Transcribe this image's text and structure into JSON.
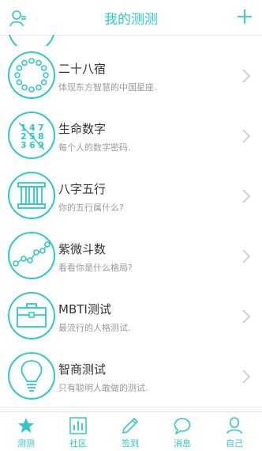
{
  "colors": {
    "accent": "#2ec9c7",
    "text": "#333333",
    "subtext": "#9a9a9a"
  },
  "header": {
    "title": "我的测测",
    "left_icon": "user-icon",
    "right_icon": "plus-icon"
  },
  "list": {
    "items": [
      {
        "name": "二十八宿",
        "desc": "体现东方智慧的中国星座.",
        "icon": "constellation-ring-icon"
      },
      {
        "name": "生命数字",
        "desc": "每个人的数字密码.",
        "icon": "number-grid-icon",
        "icon_digits": [
          "1",
          "4",
          "7",
          "2",
          "5",
          "8",
          "3",
          "6",
          "9"
        ]
      },
      {
        "name": "八字五行",
        "desc": "你的五行属什么?",
        "icon": "pillars-icon"
      },
      {
        "name": "紫微斗数",
        "desc": "看看你是什么格局?",
        "icon": "star-chart-icon"
      },
      {
        "name": "MBTI测试",
        "desc": "最流行的人格测试.",
        "icon": "briefcase-icon"
      },
      {
        "name": "智商测试",
        "desc": "只有聪明人敢做的测试.",
        "icon": "lightbulb-icon"
      }
    ]
  },
  "tabbar": {
    "tabs": [
      {
        "label": "测测",
        "icon": "star-icon"
      },
      {
        "label": "社区",
        "icon": "bar-chart-icon"
      },
      {
        "label": "签到",
        "icon": "pen-icon"
      },
      {
        "label": "消息",
        "icon": "chat-bubble-icon"
      },
      {
        "label": "自己",
        "icon": "person-icon"
      }
    ]
  }
}
